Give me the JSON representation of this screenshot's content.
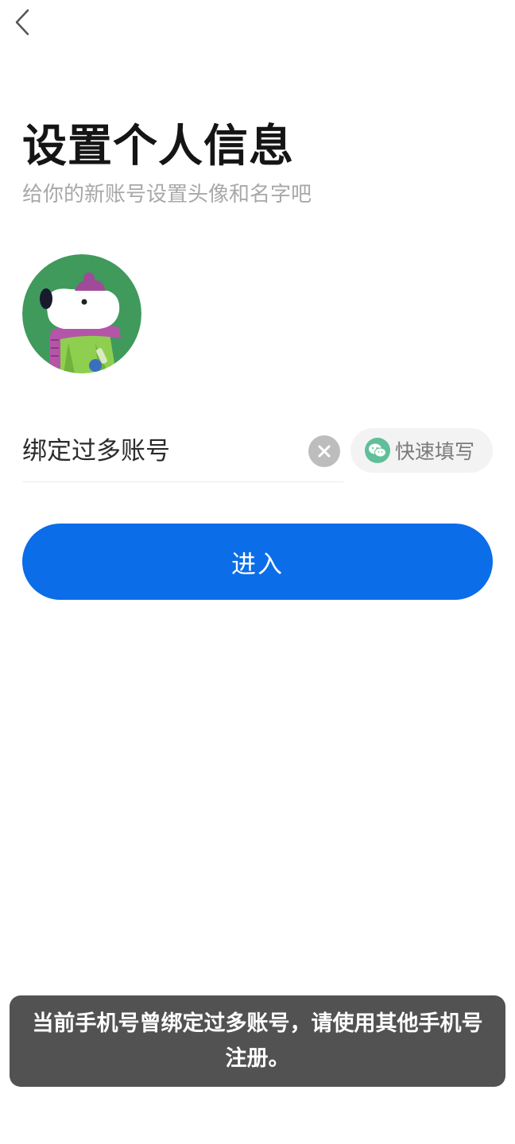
{
  "header": {
    "back_icon": "chevron-left-icon"
  },
  "page": {
    "title": "设置个人信息",
    "subtitle": "给你的新账号设置头像和名字吧"
  },
  "avatar": {
    "description_icon": "cartoon-dog-avatar"
  },
  "name_field": {
    "value": "绑定过多账号",
    "clear_icon": "clear-icon"
  },
  "quick_fill": {
    "icon": "wechat-icon",
    "label": "快速填写"
  },
  "enter_button": {
    "label": "进入"
  },
  "toast": {
    "message": "当前手机号曾绑定过多账号，请使用其他手机号注册。"
  },
  "colors": {
    "primary": "#0b6de8",
    "toast_bg": "#525252",
    "avatar_bg": "#3f9a5c",
    "wechat_green": "#5fbf98"
  }
}
